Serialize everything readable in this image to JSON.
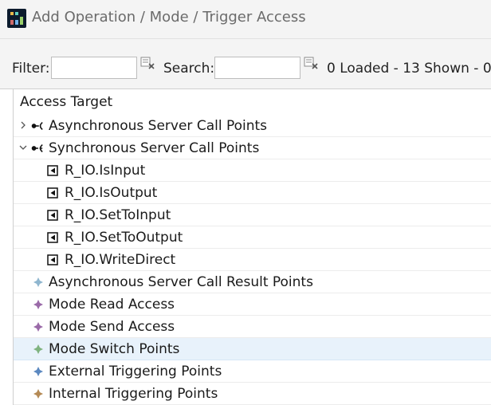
{
  "window": {
    "title": "Add Operation / Mode / Trigger Access"
  },
  "toolbar": {
    "filter_label": "Filter:",
    "filter_value": "",
    "search_label": "Search:",
    "search_value": "",
    "status": "0 Loaded - 13 Shown - 0"
  },
  "tree": {
    "header": "Access Target",
    "rows": [
      {
        "label": "Asynchronous Server Call Points",
        "expanded": false,
        "icon": "async-call-icon"
      },
      {
        "label": "Synchronous Server Call Points",
        "expanded": true,
        "icon": "sync-call-icon"
      },
      {
        "label": "R_IO.IsInput",
        "icon": "operation-icon"
      },
      {
        "label": "R_IO.IsOutput",
        "icon": "operation-icon"
      },
      {
        "label": "R_IO.SetToInput",
        "icon": "operation-icon"
      },
      {
        "label": "R_IO.SetToOutput",
        "icon": "operation-icon"
      },
      {
        "label": "R_IO.WriteDirect",
        "icon": "operation-icon"
      },
      {
        "label": "Asynchronous Server Call Result Points",
        "icon": "diamond-icon",
        "color": "#8fb6cf"
      },
      {
        "label": "Mode Read Access",
        "icon": "diamond-icon",
        "color": "#9a6aa8"
      },
      {
        "label": "Mode Send Access",
        "icon": "diamond-icon",
        "color": "#9a6aa8"
      },
      {
        "label": "Mode Switch Points",
        "icon": "diamond-icon",
        "color": "#7fb37f",
        "selected": true
      },
      {
        "label": "External Triggering Points",
        "icon": "diamond-icon",
        "color": "#5b88c0"
      },
      {
        "label": "Internal Triggering Points",
        "icon": "diamond-icon",
        "color": "#b58a55"
      }
    ]
  }
}
